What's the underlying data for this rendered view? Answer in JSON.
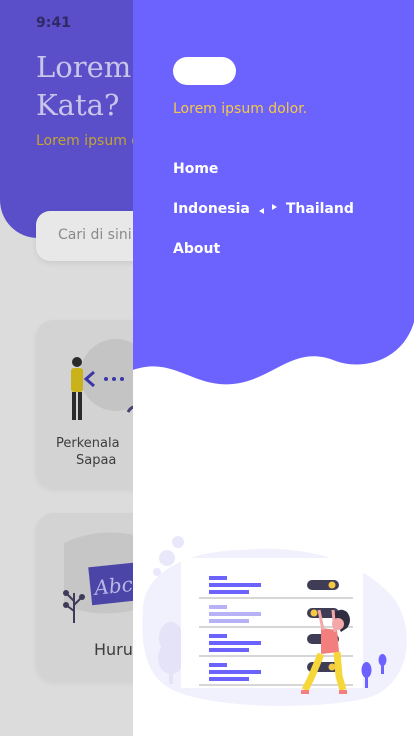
{
  "status_bar": {
    "time": "9:41"
  },
  "hero": {
    "title_line1": "Lorem I",
    "title_line2": "Kata?",
    "subtitle": "Lorem ipsum d"
  },
  "search": {
    "placeholder": "Cari di sini..."
  },
  "cards": [
    {
      "label_line1": "Perkenala",
      "label_line2": "Sapaa"
    },
    {
      "label_line1": "Huruf"
    }
  ],
  "drawer": {
    "tagline": "Lorem ipsum dolor.",
    "nav": {
      "home": "Home",
      "lang_from": "Indonesia",
      "lang_to": "Thailand",
      "about": "About"
    }
  },
  "colors": {
    "drawer_accent": "#6c63ff",
    "tagline": "#f5c844",
    "header_dimmed": "#5a4fc9"
  }
}
